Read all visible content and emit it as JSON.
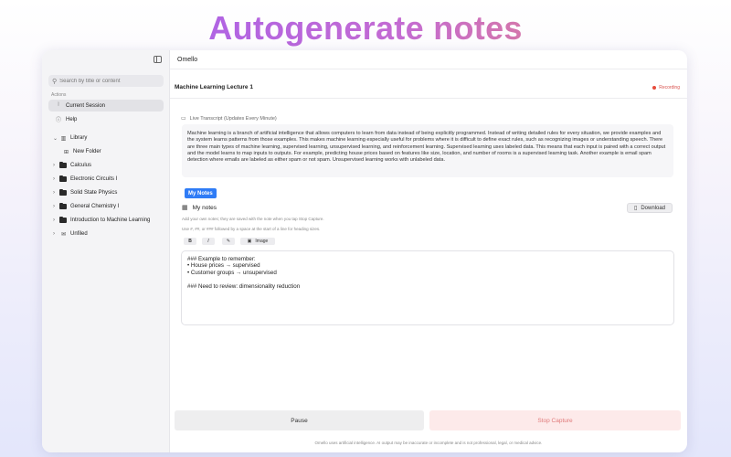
{
  "headline": "Autogenerate notes",
  "app_title": "Omello",
  "sidebar": {
    "search_placeholder": "Search by title or content",
    "section_label": "Actions",
    "actions": [
      {
        "label": "Current Session",
        "icon": "waveform-icon"
      },
      {
        "label": "Help",
        "icon": "help-circle-icon"
      }
    ],
    "library": {
      "label": "Library",
      "new_folder": "New Folder",
      "folders": [
        "Calculus",
        "Electronic Circuits I",
        "Solid State Physics",
        "General Chemistry I",
        "Introduction to Machine Learning"
      ],
      "unfiled": "Unfiled"
    }
  },
  "session": {
    "title": "Machine Learning Lecture 1",
    "status": "Recording",
    "transcript_label": "Live Transcript (Updates Every Minute)",
    "transcript": "Machine learning is a branch of artificial intelligence that allows computers to learn from data instead of being explicitly programmed. Instead of writing detailed rules for every situation, we provide examples and the system learns patterns from those examples. This makes machine learning especially useful for problems where it is difficult to define exact rules, such as recognizing images or understanding speech. There are three main types of machine learning, supervised learning, unsupervised learning, and reinforcement learning. Supervised learning uses labeled data. This means that each input is paired with a correct output and the model learns to map inputs to outputs. For example, predicting house prices based on features like size, location, and number of rooms is a supervised learning task. Another example is email spam detection where emails are labeled as either spam or not spam. Unsupervised learning works with unlabeled data."
  },
  "notes": {
    "tab_label": "My Notes",
    "heading": "My notes",
    "download_label": "Download",
    "hint1": "Add your own notes; they are saved with the note when you tap Stop Capture.",
    "hint2": "Use #, ##, or ### followed by a space at the start of a line for heading sizes.",
    "toolbar": {
      "bold": "B",
      "italic": "I",
      "image": "Image"
    },
    "content": "### Example to remember:\n• House prices → supervised\n• Customer groups → unsupervised\n\n### Need to review: dimensionality reduction"
  },
  "controls": {
    "pause": "Pause",
    "stop": "Stop Capture"
  },
  "disclaimer": "Omello uses artificial intelligence. AI output may be inaccurate or incomplete and is not professional, legal, or medical advice.",
  "colors": {
    "accent": "#2f7cf6",
    "recording": "#e74c3c",
    "stop_bg": "#fdeaea"
  }
}
